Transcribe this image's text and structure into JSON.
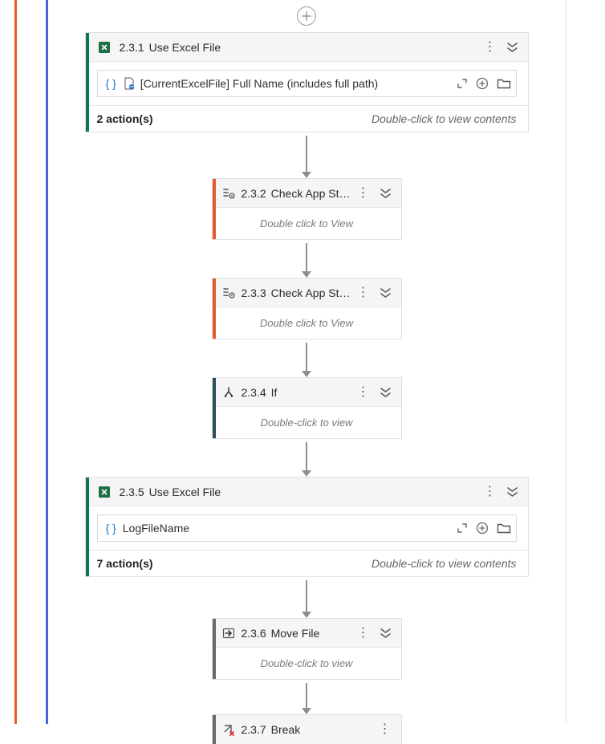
{
  "addButtonGlyph": "+",
  "menuDotsGlyph": "⋮",
  "collapseGlyph": "⌄",
  "expandCornerGlyph": "⤢",
  "plusCircleGlyph": "⊕",
  "nodes": {
    "n231": {
      "num": "2.3.1",
      "title": "Use Excel File",
      "input_text": "[CurrentExcelFile] Full Name (includes full path)",
      "actions_count": "2 action(s)",
      "hint": "Double-click to view contents"
    },
    "n232": {
      "num": "2.3.2",
      "title": "Check App St…",
      "body": "Double click to View"
    },
    "n233": {
      "num": "2.3.3",
      "title": "Check App St…",
      "body": "Double click to View"
    },
    "n234": {
      "num": "2.3.4",
      "title": "If",
      "body": "Double-click to view"
    },
    "n235": {
      "num": "2.3.5",
      "title": "Use Excel File",
      "input_text": "LogFileName",
      "actions_count": "7 action(s)",
      "hint": "Double-click to view contents"
    },
    "n236": {
      "num": "2.3.6",
      "title": "Move File",
      "body": "Double-click to view"
    },
    "n237": {
      "num": "2.3.7",
      "title": "Break"
    }
  }
}
